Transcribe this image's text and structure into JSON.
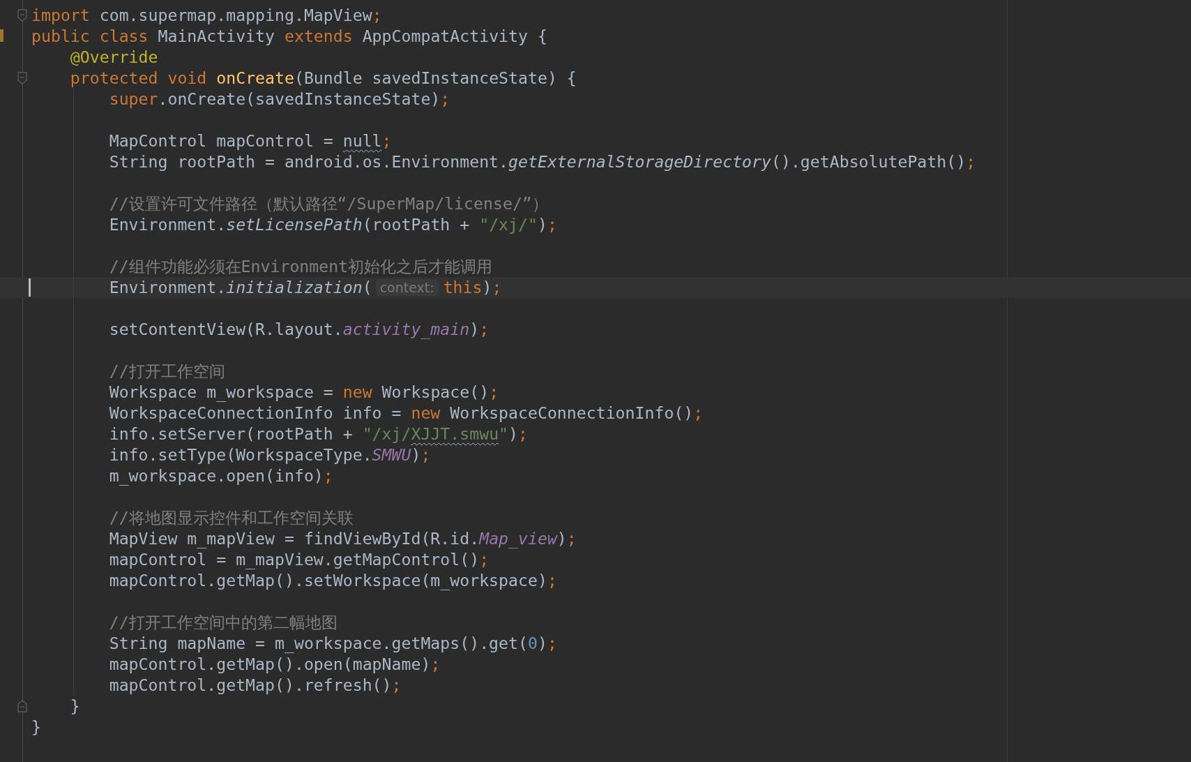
{
  "editor": {
    "lines": [
      {
        "kind": "code",
        "selected": false,
        "changed": false,
        "fold_start": true,
        "fold_end": false,
        "tokens": [
          {
            "kind": "keyword",
            "text": "import "
          },
          {
            "kind": "plain",
            "text": "com.supermap.mapping.MapView"
          },
          {
            "kind": "keyword",
            "text": ";"
          }
        ]
      },
      {
        "kind": "code",
        "selected": false,
        "changed": true,
        "tokens": [
          {
            "kind": "keyword",
            "text": "public class "
          },
          {
            "kind": "plain",
            "text": "MainActivity "
          },
          {
            "kind": "keyword",
            "text": "extends "
          },
          {
            "kind": "plain",
            "text": "AppCompatActivity {"
          }
        ]
      },
      {
        "kind": "code",
        "selected": false,
        "changed": false,
        "tokens": [
          {
            "kind": "annotation",
            "text": "    @Override"
          }
        ]
      },
      {
        "kind": "code",
        "selected": false,
        "changed": false,
        "fold_start": true,
        "fold_end": false,
        "tokens": [
          {
            "kind": "keyword",
            "text": "    protected void "
          },
          {
            "kind": "declaration",
            "text": "onCreate"
          },
          {
            "kind": "plain",
            "text": "(Bundle savedInstanceState) {"
          }
        ]
      },
      {
        "kind": "code",
        "selected": false,
        "changed": false,
        "tokens": [
          {
            "kind": "keyword",
            "text": "        super"
          },
          {
            "kind": "plain",
            "text": ".onCreate(savedInstanceState)"
          },
          {
            "kind": "keyword",
            "text": ";"
          }
        ]
      },
      {
        "kind": "blank"
      },
      {
        "kind": "code",
        "selected": false,
        "changed": false,
        "tokens": [
          {
            "kind": "plain",
            "text": "        MapControl mapControl = "
          },
          {
            "kind": "plain",
            "text": "null",
            "squiggle": true
          },
          {
            "kind": "keyword",
            "text": ";"
          }
        ]
      },
      {
        "kind": "code",
        "selected": false,
        "changed": false,
        "tokens": [
          {
            "kind": "plain",
            "text": "        String rootPath = android.os.Environment."
          },
          {
            "kind": "static",
            "text": "getExternalStorageDirectory"
          },
          {
            "kind": "plain",
            "text": "().getAbsolutePath()"
          },
          {
            "kind": "keyword",
            "text": ";"
          }
        ]
      },
      {
        "kind": "blank"
      },
      {
        "kind": "code",
        "selected": false,
        "changed": false,
        "tokens": [
          {
            "kind": "comment",
            "text": "        //设置许可文件路径（默认路径“/SuperMap/license/”）"
          }
        ]
      },
      {
        "kind": "code",
        "selected": false,
        "changed": false,
        "tokens": [
          {
            "kind": "plain",
            "text": "        Environment."
          },
          {
            "kind": "static",
            "text": "setLicensePath"
          },
          {
            "kind": "plain",
            "text": "(rootPath + "
          },
          {
            "kind": "string",
            "text": "\"/xj/\""
          },
          {
            "kind": "plain",
            "text": ")"
          },
          {
            "kind": "keyword",
            "text": ";"
          }
        ]
      },
      {
        "kind": "blank"
      },
      {
        "kind": "code",
        "selected": false,
        "changed": false,
        "tokens": [
          {
            "kind": "comment",
            "text": "        //组件功能必须在Environment初始化之后才能调用"
          }
        ]
      },
      {
        "kind": "code",
        "selected": true,
        "changed": false,
        "tokens": [
          {
            "kind": "plain",
            "text": "        Environment."
          },
          {
            "kind": "static",
            "text": "initialization"
          },
          {
            "kind": "plain",
            "text": "("
          },
          {
            "kind": "hint",
            "text": "context:"
          },
          {
            "kind": "keyword",
            "text": "this"
          },
          {
            "kind": "plain",
            "text": ")"
          },
          {
            "kind": "keyword",
            "text": ";"
          }
        ]
      },
      {
        "kind": "blank"
      },
      {
        "kind": "code",
        "selected": false,
        "changed": false,
        "tokens": [
          {
            "kind": "plain",
            "text": "        setContentView(R.layout."
          },
          {
            "kind": "field",
            "text": "activity_main"
          },
          {
            "kind": "plain",
            "text": ")"
          },
          {
            "kind": "keyword",
            "text": ";"
          }
        ]
      },
      {
        "kind": "blank"
      },
      {
        "kind": "code",
        "selected": false,
        "changed": false,
        "tokens": [
          {
            "kind": "comment",
            "text": "        //打开工作空间"
          }
        ]
      },
      {
        "kind": "code",
        "selected": false,
        "changed": false,
        "tokens": [
          {
            "kind": "plain",
            "text": "        Workspace m_workspace = "
          },
          {
            "kind": "keyword",
            "text": "new "
          },
          {
            "kind": "plain",
            "text": "Workspace()"
          },
          {
            "kind": "keyword",
            "text": ";"
          }
        ]
      },
      {
        "kind": "code",
        "selected": false,
        "changed": false,
        "tokens": [
          {
            "kind": "plain",
            "text": "        WorkspaceConnectionInfo info = "
          },
          {
            "kind": "keyword",
            "text": "new "
          },
          {
            "kind": "plain",
            "text": "WorkspaceConnectionInfo()"
          },
          {
            "kind": "keyword",
            "text": ";"
          }
        ]
      },
      {
        "kind": "code",
        "selected": false,
        "changed": false,
        "tokens": [
          {
            "kind": "plain",
            "text": "        info.setServer(rootPath + "
          },
          {
            "kind": "string",
            "text": "\"/xj/"
          },
          {
            "kind": "string",
            "text": "XJJT.smwu",
            "squiggle": true
          },
          {
            "kind": "string",
            "text": "\""
          },
          {
            "kind": "plain",
            "text": ")"
          },
          {
            "kind": "keyword",
            "text": ";"
          }
        ]
      },
      {
        "kind": "code",
        "selected": false,
        "changed": false,
        "tokens": [
          {
            "kind": "plain",
            "text": "        info.setType(WorkspaceType."
          },
          {
            "kind": "field",
            "text": "SMWU"
          },
          {
            "kind": "plain",
            "text": ")"
          },
          {
            "kind": "keyword",
            "text": ";"
          }
        ]
      },
      {
        "kind": "code",
        "selected": false,
        "changed": false,
        "tokens": [
          {
            "kind": "plain",
            "text": "        m_workspace.open(info)"
          },
          {
            "kind": "keyword",
            "text": ";"
          }
        ]
      },
      {
        "kind": "blank"
      },
      {
        "kind": "code",
        "selected": false,
        "changed": false,
        "tokens": [
          {
            "kind": "comment",
            "text": "        //将地图显示控件和工作空间关联"
          }
        ]
      },
      {
        "kind": "code",
        "selected": false,
        "changed": false,
        "tokens": [
          {
            "kind": "plain",
            "text": "        MapView m_mapView = findViewById(R.id."
          },
          {
            "kind": "field",
            "text": "Map_view"
          },
          {
            "kind": "plain",
            "text": ")"
          },
          {
            "kind": "keyword",
            "text": ";"
          }
        ]
      },
      {
        "kind": "code",
        "selected": false,
        "changed": false,
        "tokens": [
          {
            "kind": "plain",
            "text": "        mapControl = m_mapView.getMapControl()"
          },
          {
            "kind": "keyword",
            "text": ";"
          }
        ]
      },
      {
        "kind": "code",
        "selected": false,
        "changed": false,
        "tokens": [
          {
            "kind": "plain",
            "text": "        mapControl.getMap().setWorkspace(m_workspace)"
          },
          {
            "kind": "keyword",
            "text": ";"
          }
        ]
      },
      {
        "kind": "blank"
      },
      {
        "kind": "code",
        "selected": false,
        "changed": false,
        "tokens": [
          {
            "kind": "comment",
            "text": "        //打开工作空间中的第二幅地图"
          }
        ]
      },
      {
        "kind": "code",
        "selected": false,
        "changed": false,
        "tokens": [
          {
            "kind": "plain",
            "text": "        String mapName = m_workspace.getMaps().get("
          },
          {
            "kind": "number",
            "text": "0"
          },
          {
            "kind": "plain",
            "text": ")"
          },
          {
            "kind": "keyword",
            "text": ";"
          }
        ]
      },
      {
        "kind": "code",
        "selected": false,
        "changed": false,
        "tokens": [
          {
            "kind": "plain",
            "text": "        mapControl.getMap().open(mapName)"
          },
          {
            "kind": "keyword",
            "text": ";"
          }
        ]
      },
      {
        "kind": "code",
        "selected": false,
        "changed": false,
        "tokens": [
          {
            "kind": "plain",
            "text": "        mapControl.getMap().refresh()"
          },
          {
            "kind": "keyword",
            "text": ";"
          }
        ]
      },
      {
        "kind": "code",
        "selected": false,
        "changed": false,
        "fold_start": false,
        "fold_end": true,
        "tokens": [
          {
            "kind": "plain",
            "text": "    }"
          }
        ]
      },
      {
        "kind": "code",
        "selected": false,
        "changed": false,
        "tokens": [
          {
            "kind": "plain",
            "text": "}"
          }
        ]
      }
    ]
  }
}
